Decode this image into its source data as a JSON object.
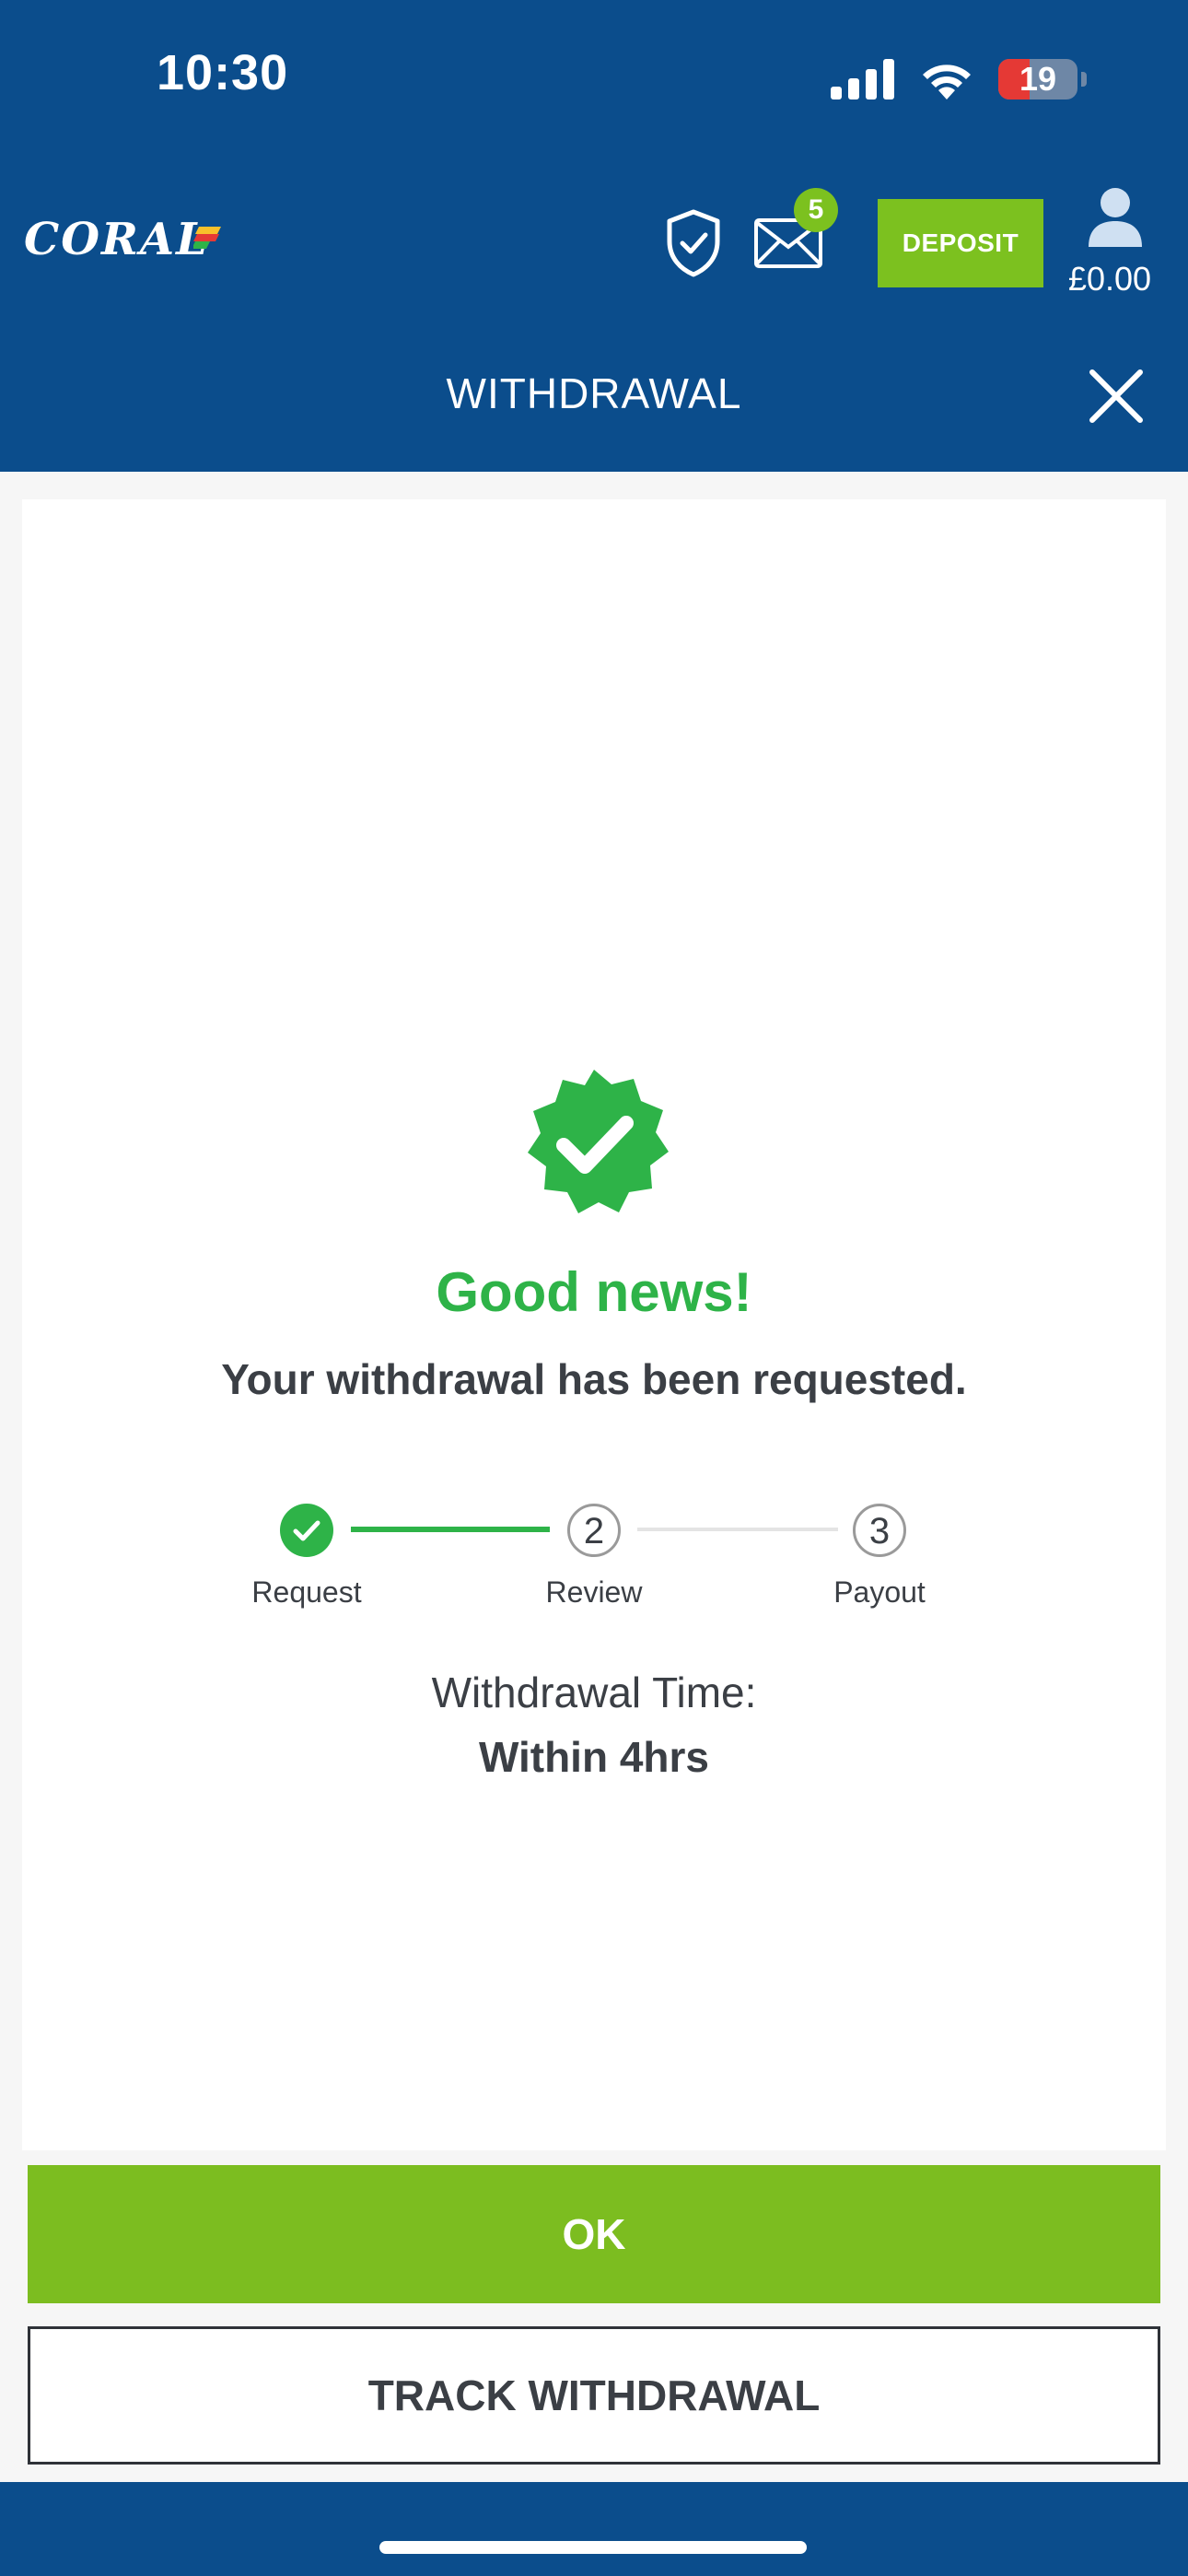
{
  "status_bar": {
    "time": "10:30",
    "battery": "19",
    "icons": [
      "signal-icon",
      "wifi-icon",
      "battery-icon"
    ]
  },
  "header": {
    "logo": "CORAL",
    "messages_badge": "5",
    "deposit_label": "DEPOSIT",
    "balance": "£0.00",
    "icons": [
      "shield-check-icon",
      "mail-icon",
      "user-icon"
    ]
  },
  "title_bar": {
    "title": "WITHDRAWAL",
    "close_icon": "close-icon"
  },
  "content": {
    "heading": "Good news!",
    "message": "Your withdrawal has been requested.",
    "steps": [
      {
        "number": "1",
        "label": "Request",
        "state": "complete"
      },
      {
        "number": "2",
        "label": "Review",
        "state": "pending"
      },
      {
        "number": "3",
        "label": "Payout",
        "state": "pending"
      }
    ],
    "withdrawal_time_label": "Withdrawal Time:",
    "withdrawal_time_value": "Within 4hrs"
  },
  "actions": {
    "ok_label": "OK",
    "track_label": "TRACK WITHDRAWAL"
  },
  "colors": {
    "brand_blue": "#0b4d8c",
    "accent_green": "#7cbd20",
    "success_green": "#2eb348",
    "text_dark": "#3b3f45"
  }
}
